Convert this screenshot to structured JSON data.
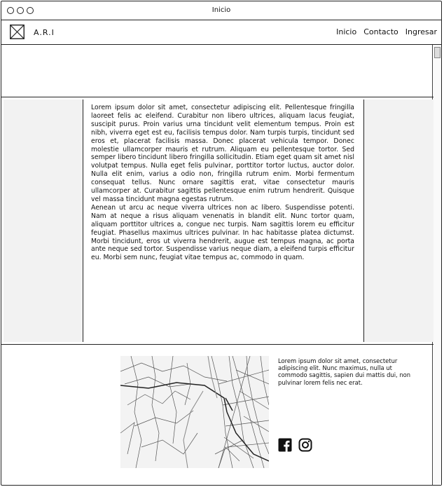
{
  "window": {
    "title": "Inicio"
  },
  "navbar": {
    "logo_text": "A.R.I",
    "links": [
      "Inicio",
      "Contacto",
      "Ingresar"
    ]
  },
  "article": {
    "paragraph_1": "Lorem ipsum dolor sit amet, consectetur adipiscing elit. Pellentesque fringilla laoreet felis ac eleifend. Curabitur non libero ultrices, aliquam lacus feugiat, suscipit purus. Proin varius urna tincidunt velit elementum tempus. Proin est nibh, viverra eget est eu, facilisis tempus dolor. Nam turpis turpis, tincidunt sed eros et, placerat facilisis massa. Donec placerat vehicula tempor. Donec molestie ullamcorper mauris et rutrum. Aliquam eu pellentesque tortor. Sed semper libero tincidunt libero fringilla sollicitudin. Etiam eget quam sit amet nisl volutpat tempus. Nulla eget felis pulvinar, porttitor tortor luctus, auctor dolor. Nulla elit enim, varius a odio non, fringilla rutrum enim. Morbi fermentum consequat tellus. Nunc ornare sagittis erat, vitae consectetur mauris ullamcorper at. Curabitur sagittis pellentesque enim rutrum hendrerit. Quisque vel massa tincidunt magna egestas rutrum.",
    "paragraph_2": "Aenean ut arcu ac neque viverra ultrices non ac libero. Suspendisse potenti. Nam at neque a risus aliquam venenatis in blandit elit. Nunc tortor quam, aliquam porttitor ultrices a, congue nec turpis. Nam sagittis lorem eu efficitur feugiat. Phasellus maximus ultrices pulvinar. In hac habitasse platea dictumst. Morbi tincidunt, eros ut viverra hendrerit, augue est tempus magna, ac porta ante neque sed tortor. Suspendisse varius neque diam, a eleifend turpis efficitur eu. Morbi sem nunc, feugiat vitae tempus ac, commodo in quam."
  },
  "footer": {
    "text": "Lorem ipsum dolor sit amet, consectetur adipiscing elit. Nunc maximus, nulla ut commodo sagittis, sapien dui mattis dui, non pulvinar lorem felis nec erat.",
    "social_icons": [
      "facebook-icon",
      "instagram-icon"
    ]
  }
}
